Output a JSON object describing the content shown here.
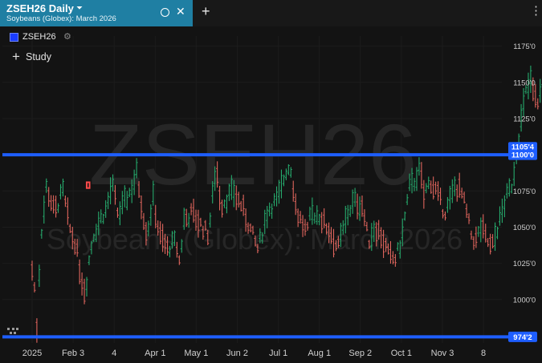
{
  "tab": {
    "title": "ZSEH26 Daily",
    "subtitle": "Soybeans (Globex): March 2026",
    "caret": "⏷",
    "close": "✕",
    "add": "+"
  },
  "menu": {
    "kebab": "⋮"
  },
  "legend": {
    "symbol": "ZSEH26",
    "swatch_color": "#1a3cff",
    "gear": "⚙"
  },
  "study": {
    "plus": "+",
    "label": "Study"
  },
  "colors": {
    "background": "#131313",
    "up": "#26a96c",
    "down": "#e0655d",
    "hline": "#1e5eff",
    "box": "#ff4a4a",
    "watermark": "#262626"
  },
  "chart_data": {
    "type": "ohlc",
    "watermark": {
      "symbol": "ZSEH26",
      "description": "Soybeans (Globex): March 2026"
    },
    "x_labels": [
      "2025",
      "Feb 3",
      "4",
      "Apr 1",
      "May 1",
      "Jun 2",
      "Jul 1",
      "Aug 1",
      "Sep 2",
      "Oct 1",
      "Nov 3",
      "8"
    ],
    "y_ticks": [
      "1175'0",
      "1150'0",
      "1125'0",
      "1075'0",
      "1050'0",
      "1025'0",
      "1000'0"
    ],
    "ylim": [
      970,
      1182
    ],
    "last_price_label": "1105'4",
    "last_price": 1105.5,
    "horizontal_lines": [
      {
        "value": 1100.0,
        "label": "1100'0"
      },
      {
        "value": 974.25,
        "label": "974'2"
      }
    ],
    "highlight_box": {
      "x_from": 1.33,
      "x_to": 1.4,
      "y_low": 1077,
      "y_high": 1081
    },
    "keypoints": [
      [
        0.0,
        1020
      ],
      [
        0.1,
        1000
      ],
      [
        0.12,
        975
      ],
      [
        0.2,
        1040
      ],
      [
        0.35,
        1078
      ],
      [
        0.55,
        1060
      ],
      [
        0.75,
        1075
      ],
      [
        0.95,
        1045
      ],
      [
        1.05,
        1040
      ],
      [
        1.2,
        1015
      ],
      [
        1.3,
        1005
      ],
      [
        1.4,
        1030
      ],
      [
        1.5,
        1045
      ],
      [
        1.65,
        1055
      ],
      [
        1.8,
        1062
      ],
      [
        1.95,
        1080
      ],
      [
        2.1,
        1058
      ],
      [
        2.3,
        1070
      ],
      [
        2.45,
        1078
      ],
      [
        2.55,
        1088
      ],
      [
        2.7,
        1060
      ],
      [
        2.8,
        1045
      ],
      [
        2.95,
        1070
      ],
      [
        3.1,
        1045
      ],
      [
        3.3,
        1035
      ],
      [
        3.5,
        1040
      ],
      [
        3.6,
        1025
      ],
      [
        3.7,
        1055
      ],
      [
        3.9,
        1060
      ],
      [
        4.1,
        1052
      ],
      [
        4.3,
        1045
      ],
      [
        4.45,
        1085
      ],
      [
        4.5,
        1090
      ],
      [
        4.6,
        1065
      ],
      [
        4.75,
        1070
      ],
      [
        4.9,
        1075
      ],
      [
        5.1,
        1065
      ],
      [
        5.3,
        1050
      ],
      [
        5.5,
        1035
      ],
      [
        5.6,
        1045
      ],
      [
        5.75,
        1062
      ],
      [
        6.0,
        1070
      ],
      [
        6.2,
        1090
      ],
      [
        6.3,
        1092
      ],
      [
        6.45,
        1060
      ],
      [
        6.55,
        1055
      ],
      [
        6.7,
        1045
      ],
      [
        6.8,
        1060
      ],
      [
        7.0,
        1058
      ],
      [
        7.3,
        1045
      ],
      [
        7.45,
        1035
      ],
      [
        7.6,
        1050
      ],
      [
        7.7,
        1060
      ],
      [
        7.85,
        1068
      ],
      [
        8.05,
        1065
      ],
      [
        8.2,
        1040
      ],
      [
        8.35,
        1050
      ],
      [
        8.5,
        1045
      ],
      [
        8.7,
        1030
      ],
      [
        8.85,
        1028
      ],
      [
        9.0,
        1040
      ],
      [
        9.1,
        1060
      ],
      [
        9.2,
        1078
      ],
      [
        9.3,
        1080
      ],
      [
        9.35,
        1085
      ],
      [
        9.45,
        1090
      ],
      [
        9.55,
        1072
      ],
      [
        9.7,
        1082
      ],
      [
        9.85,
        1075
      ],
      [
        10.05,
        1060
      ],
      [
        10.15,
        1065
      ],
      [
        10.3,
        1078
      ],
      [
        10.45,
        1075
      ],
      [
        10.55,
        1065
      ],
      [
        10.7,
        1045
      ],
      [
        10.8,
        1040
      ],
      [
        10.95,
        1050
      ],
      [
        11.1,
        1040
      ],
      [
        11.2,
        1035
      ],
      [
        11.35,
        1050
      ],
      [
        11.55,
        1070
      ],
      [
        11.7,
        1080
      ],
      [
        11.85,
        1110
      ],
      [
        11.95,
        1130
      ],
      [
        12.05,
        1145
      ],
      [
        12.15,
        1150
      ],
      [
        12.3,
        1135
      ],
      [
        12.4,
        1145
      ],
      [
        12.55,
        1165
      ],
      [
        12.65,
        1160
      ],
      [
        12.8,
        1135
      ],
      [
        12.95,
        1140
      ],
      [
        13.05,
        1145
      ],
      [
        13.15,
        1130
      ],
      [
        13.25,
        1108
      ]
    ]
  }
}
